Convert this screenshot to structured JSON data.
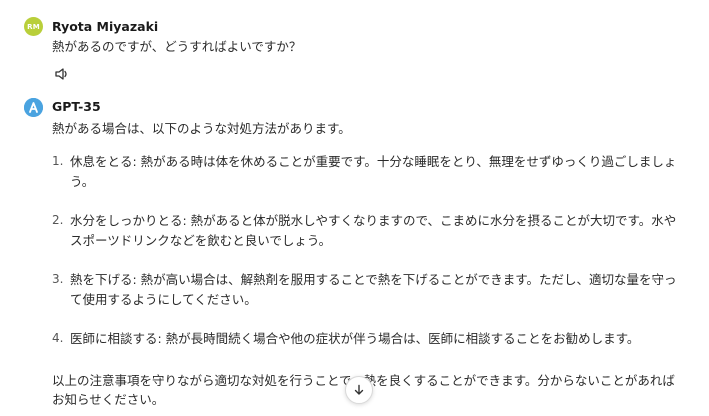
{
  "messages": {
    "user": {
      "initials": "RM",
      "name": "Ryota Miyazaki",
      "text": "熱があるのですが、どうすればよいですか？",
      "avatar_color": "#b9cf3a",
      "icons": [
        "speaker-icon"
      ]
    },
    "assistant": {
      "name": "GPT-35",
      "avatar_color": "#4aa3e0",
      "intro": "熱がある場合は、以下のような対処方法があります。",
      "steps": [
        {
          "num": "1.",
          "text": "休息をとる: 熱がある時は体を休めることが重要です。十分な睡眠をとり、無理をせずゆっくり過ごしましょう。"
        },
        {
          "num": "2.",
          "text": "水分をしっかりとる: 熱があると体が脱水しやすくなりますので、こまめに水分を摂ることが大切です。水やスポーツドリンクなどを飲むと良いでしょう。"
        },
        {
          "num": "3.",
          "text": "熱を下げる: 熱が高い場合は、解熱剤を服用することで熱を下げることができます。ただし、適切な量を守って使用するようにしてください。"
        },
        {
          "num": "4.",
          "text": "医師に相談する: 熱が長時間続く場合や他の症状が伴う場合は、医師に相談することをお勧めします。"
        }
      ],
      "outro": "以上の注意事項を守りながら適切な対処を行うことで、熱を良くすることができます。分からないことがあればお知らせください。"
    }
  },
  "scroll_down": {
    "icon": "arrow-down-icon"
  }
}
